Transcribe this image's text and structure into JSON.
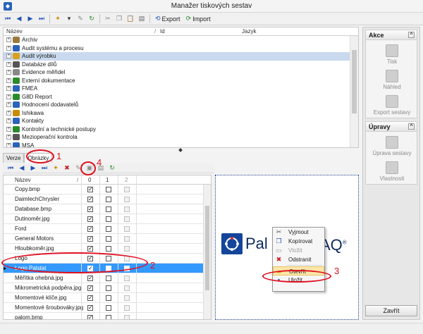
{
  "window": {
    "title": "Manažer tiskových sestav"
  },
  "toolbar": {
    "export_label": "Export",
    "import_label": "Import"
  },
  "tree": {
    "columns": [
      "Název",
      "Id",
      "Jazyk"
    ],
    "items": [
      {
        "label": "Archiv",
        "selected": false
      },
      {
        "label": "Audit systému a procesu",
        "selected": false
      },
      {
        "label": "Audit výrobku",
        "selected": true
      },
      {
        "label": "Databáze dílů",
        "selected": false
      },
      {
        "label": "Evidence měřidel",
        "selected": false
      },
      {
        "label": "Externí dokumentace",
        "selected": false
      },
      {
        "label": "FMEA",
        "selected": false
      },
      {
        "label": "G8D Report",
        "selected": false
      },
      {
        "label": "Hodnocení dodavatelů",
        "selected": false
      },
      {
        "label": "Ishikawa",
        "selected": false
      },
      {
        "label": "Kontakty",
        "selected": false
      },
      {
        "label": "Kontrolní a technické postupy",
        "selected": false
      },
      {
        "label": "Mezioperační kontrola",
        "selected": false
      },
      {
        "label": "MSA",
        "selected": false
      }
    ]
  },
  "tabs": [
    {
      "label": "Verze",
      "active": false
    },
    {
      "label": "Obrázky",
      "active": true
    }
  ],
  "table": {
    "columns": {
      "name": "Název",
      "c0": "0",
      "c1": "1",
      "c2": "2"
    },
    "rows": [
      {
        "name": "Copy.bmp",
        "c0": true,
        "c1": false
      },
      {
        "name": "DaimlechChrysler",
        "c0": true,
        "c1": false
      },
      {
        "name": "Database.bmp",
        "c0": true,
        "c1": false
      },
      {
        "name": "Dutinoměr.jpg",
        "c0": true,
        "c1": false
      },
      {
        "name": "Ford",
        "c0": true,
        "c1": false
      },
      {
        "name": "General Motors",
        "c0": true,
        "c1": false
      },
      {
        "name": "Hloubkoměr.jpg",
        "c0": true,
        "c1": false
      },
      {
        "name": "Logo",
        "c0": true,
        "c1": false
      },
      {
        "name": "Logo Palstat",
        "c0": true,
        "c1": false,
        "selected": true
      },
      {
        "name": "Měřítka ohebná.jpg",
        "c0": true,
        "c1": false
      },
      {
        "name": "Mikrometrická podpěra.jpg",
        "c0": true,
        "c1": false
      },
      {
        "name": "Momentové klíče.jpg",
        "c0": true,
        "c1": false
      },
      {
        "name": "Momentové šroubováky.jpg",
        "c0": true,
        "c1": false
      },
      {
        "name": "palom.bmp",
        "c0": true,
        "c1": false
      }
    ]
  },
  "preview": {
    "logo_left": "Pal",
    "logo_right": "AQ",
    "logo_reg": "®"
  },
  "context_menu": {
    "items": [
      {
        "label": "Vyjmout",
        "icon": "scissors-icon",
        "disabled": false
      },
      {
        "label": "Kopírovat",
        "icon": "copy-icon",
        "disabled": false
      },
      {
        "label": "Vložit",
        "icon": "paste-icon",
        "disabled": true
      },
      {
        "label": "Odstranit",
        "icon": "delete-icon",
        "disabled": false
      },
      {
        "label": "Otevřít",
        "icon": "folder-open-icon",
        "disabled": false,
        "highlighted": true
      },
      {
        "label": "Uložit",
        "icon": "save-icon",
        "disabled": false
      }
    ]
  },
  "right_panel": {
    "group_actions": {
      "title": "Akce",
      "items": [
        "Tisk",
        "Náhled",
        "Export sestavy"
      ]
    },
    "group_edits": {
      "title": "Úpravy",
      "items": [
        "Úprava sestavy",
        "Vlastnosti"
      ]
    },
    "close_label": "Zavřít"
  },
  "annotations": [
    "1",
    "2",
    "3",
    "4"
  ],
  "colors": {
    "accent": "#3399ff",
    "annotation": "#e01020",
    "highlight": "#fbe7a8"
  }
}
